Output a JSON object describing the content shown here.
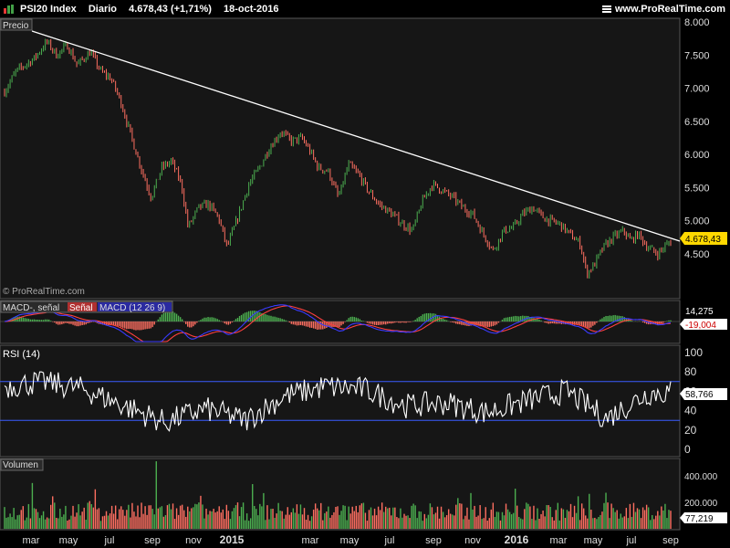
{
  "header": {
    "symbol": "PSI20 Index",
    "period": "Diario",
    "quote": "4.678,43 (+1,71%)",
    "date": "18-oct-2016",
    "site": "www.ProRealTime.com"
  },
  "panels": {
    "price": {
      "label": "Precio",
      "watermark": "© ProRealTime.com",
      "last_value": "4.678,43",
      "last_color": "#ffd800"
    },
    "macd": {
      "label_main": "MACD-, señal",
      "label_signal": "Señal",
      "label_macd": "MACD (12 26 9)",
      "value_pos": "14,275",
      "value_neg": "-19,004"
    },
    "rsi": {
      "label": "RSI (14)",
      "value": "58,766"
    },
    "volume": {
      "label": "Volumen",
      "value": "77,219"
    }
  },
  "axis_labels": {
    "price": [
      {
        "text": "8.000",
        "v": 8000
      },
      {
        "text": "7.500",
        "v": 7500
      },
      {
        "text": "7.000",
        "v": 7000
      },
      {
        "text": "6.500",
        "v": 6500
      },
      {
        "text": "6.000",
        "v": 6000
      },
      {
        "text": "5.500",
        "v": 5500
      },
      {
        "text": "5.000",
        "v": 5000
      },
      {
        "text": "4.500",
        "v": 4500
      }
    ],
    "rsi": [
      {
        "text": "100",
        "v": 100
      },
      {
        "text": "80",
        "v": 80
      },
      {
        "text": "60",
        "v": 60
      },
      {
        "text": "40",
        "v": 40
      },
      {
        "text": "20",
        "v": 20
      },
      {
        "text": "0",
        "v": 0
      }
    ],
    "volume": [
      {
        "text": "400.000",
        "v": 400000
      },
      {
        "text": "200.000",
        "v": 200000
      }
    ],
    "x": [
      {
        "text": "mar",
        "bold": false
      },
      {
        "text": "may",
        "bold": false
      },
      {
        "text": "jul",
        "bold": false
      },
      {
        "text": "sep",
        "bold": false
      },
      {
        "text": "nov",
        "bold": false
      },
      {
        "text": "2015",
        "bold": true
      },
      {
        "text": "mar",
        "bold": false
      },
      {
        "text": "may",
        "bold": false
      },
      {
        "text": "jul",
        "bold": false
      },
      {
        "text": "sep",
        "bold": false
      },
      {
        "text": "nov",
        "bold": false
      },
      {
        "text": "2016",
        "bold": true
      },
      {
        "text": "mar",
        "bold": false
      },
      {
        "text": "may",
        "bold": false
      },
      {
        "text": "jul",
        "bold": false
      },
      {
        "text": "sep",
        "bold": false
      }
    ]
  },
  "colors": {
    "up": "#4caf50",
    "down": "#ff6f61",
    "trendline": "#ffffff",
    "rsi_band": "#3a5cff",
    "macd_line": "#3a3aff",
    "signal_line": "#ff4040",
    "accent_value": "#ffd800"
  },
  "chart_data": [
    {
      "type": "line",
      "title": "PSI20 Index",
      "series": [
        {
          "name": "Precio",
          "x": [
            "2014-01-15",
            "2014-02-01",
            "2014-03-01",
            "2014-03-20",
            "2014-04-04",
            "2014-04-20",
            "2014-05-05",
            "2014-05-25",
            "2014-06-10",
            "2014-06-25",
            "2014-07-10",
            "2014-07-25",
            "2014-08-08",
            "2014-08-25",
            "2014-09-10",
            "2014-09-25",
            "2014-10-10",
            "2014-10-20",
            "2014-11-05",
            "2014-11-20",
            "2014-12-05",
            "2014-12-18",
            "2015-01-05",
            "2015-01-20",
            "2015-02-05",
            "2015-02-20",
            "2015-03-10",
            "2015-03-25",
            "2015-04-10",
            "2015-04-20",
            "2015-05-05",
            "2015-05-20",
            "2015-06-05",
            "2015-06-20",
            "2015-07-05",
            "2015-07-20",
            "2015-08-05",
            "2015-08-25",
            "2015-09-10",
            "2015-09-25",
            "2015-10-10",
            "2015-10-25",
            "2015-11-10",
            "2015-11-25",
            "2015-12-10",
            "2015-12-25",
            "2016-01-10",
            "2016-01-25",
            "2016-02-10",
            "2016-02-25",
            "2016-03-10",
            "2016-03-25",
            "2016-04-10",
            "2016-04-20",
            "2016-05-05",
            "2016-05-20",
            "2016-06-05",
            "2016-06-15",
            "2016-06-27",
            "2016-07-10",
            "2016-07-25",
            "2016-08-10",
            "2016-08-20",
            "2016-09-01",
            "2016-09-15",
            "2016-09-30",
            "2016-10-18"
          ],
          "values": [
            6950,
            7250,
            7450,
            7700,
            7500,
            7650,
            7350,
            7550,
            7250,
            7150,
            6800,
            6300,
            5850,
            5350,
            5800,
            5900,
            5550,
            4900,
            5200,
            5250,
            5050,
            4600,
            5100,
            5550,
            5800,
            6100,
            6350,
            6200,
            6250,
            6100,
            5800,
            5750,
            5350,
            5850,
            5700,
            5450,
            5250,
            5100,
            4950,
            4850,
            5300,
            5550,
            5450,
            5350,
            5200,
            5100,
            4800,
            4550,
            4850,
            4900,
            5100,
            5200,
            5050,
            5000,
            4950,
            4800,
            4650,
            4200,
            4350,
            4600,
            4750,
            4850,
            4700,
            4800,
            4600,
            4500,
            4678
          ]
        }
      ],
      "annotations": [
        "Precio"
      ],
      "ylim": [
        4200,
        8000
      ],
      "grid": false,
      "last_value": 4678.43
    },
    {
      "type": "line",
      "series": [
        {
          "name": "RSI (14)",
          "x": [
            "2014-01",
            "2014-03",
            "2014-05",
            "2014-07",
            "2014-09",
            "2014-11",
            "2015-01",
            "2015-03",
            "2015-05",
            "2015-07",
            "2015-09",
            "2015-11",
            "2016-01",
            "2016-03",
            "2016-05",
            "2016-07",
            "2016-09",
            "2016-10"
          ],
          "values": [
            65,
            70,
            62,
            45,
            28,
            42,
            30,
            55,
            65,
            62,
            45,
            48,
            38,
            50,
            60,
            32,
            58,
            59
          ]
        }
      ],
      "ylim": [
        0,
        100
      ],
      "bands": [
        70,
        30
      ]
    },
    {
      "type": "bar",
      "series": [
        {
          "name": "Volumen",
          "last_value": 77219
        }
      ],
      "ylim": [
        0,
        480000
      ]
    }
  ]
}
